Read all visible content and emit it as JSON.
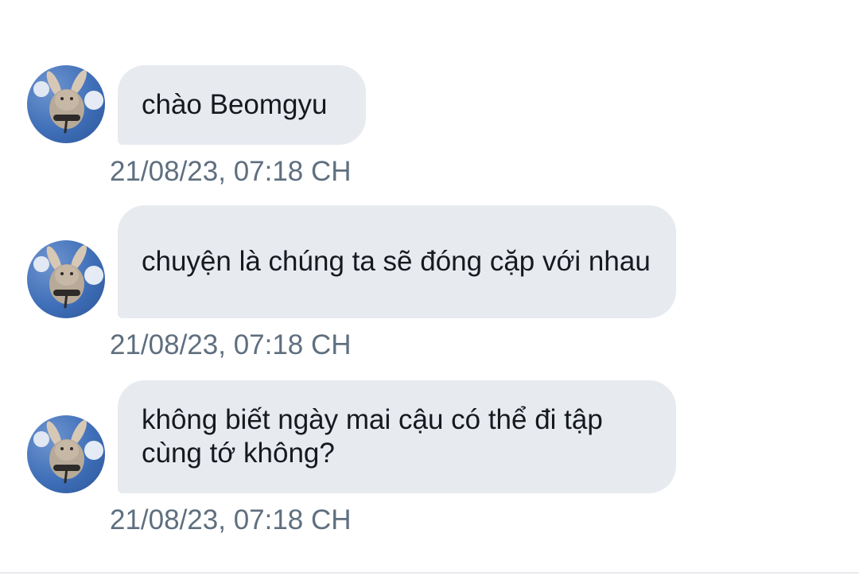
{
  "messages": [
    {
      "text": "chào Beomgyu",
      "timestamp": "21/08/23, 07:18 CH",
      "avatar_icon": "bunny-avatar"
    },
    {
      "text": "chuyện là chúng ta sẽ đóng cặp với nhau",
      "timestamp": "21/08/23, 07:18 CH",
      "avatar_icon": "bunny-avatar"
    },
    {
      "text": "không biết ngày mai cậu có thể đi tập cùng tớ không?",
      "timestamp": "21/08/23, 07:18 CH",
      "avatar_icon": "bunny-avatar"
    }
  ],
  "colors": {
    "bubble_background": "#e7ebf0",
    "timestamp_text": "#5f6f7f",
    "message_text": "#161a1f",
    "avatar_background": "#3f6fb8"
  }
}
